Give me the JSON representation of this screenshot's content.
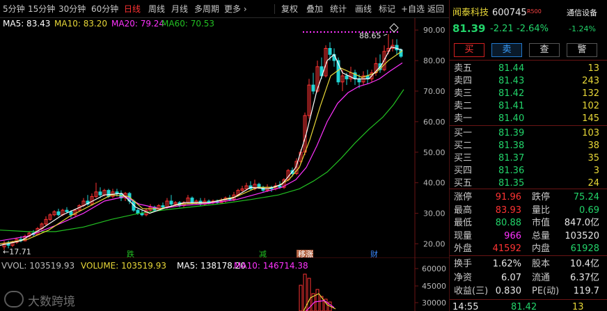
{
  "toolbar": {
    "periods": [
      "5分钟",
      "15分钟",
      "30分钟",
      "60分钟",
      "日线",
      "周线",
      "月线",
      "多周期",
      "更多 ›"
    ],
    "active": "日线",
    "actions": [
      "复权",
      "叠加",
      "统计",
      "画线",
      "标记",
      "+自选",
      "返回"
    ]
  },
  "legend": {
    "ma5": "MA5: 83.43",
    "ma10": "MA10: 83.20",
    "ma20": "MA20: 79.24",
    "ma60": "MA60: 70.53"
  },
  "chart_data": {
    "type": "candlestick",
    "y_ticks": [
      "90.00",
      "80.00",
      "70.00",
      "60.00",
      "50.00",
      "40.00",
      "30.00",
      "20.00"
    ],
    "ylim": [
      16,
      93
    ],
    "high_label": "88.65",
    "low_label": "←17.71",
    "high": 88.65,
    "low": 17.71,
    "events": [
      "跌",
      "减",
      "移涨",
      "财"
    ],
    "series": [
      {
        "name": "MA5",
        "color": "#ffffff",
        "last": 83.43
      },
      {
        "name": "MA10",
        "color": "#e8d838",
        "last": 83.2
      },
      {
        "name": "MA20",
        "color": "#ff33ff",
        "last": 79.24
      },
      {
        "name": "MA60",
        "color": "#22c022",
        "last": 70.53
      }
    ],
    "volume": {
      "ticks": [
        "60000",
        "45000",
        "30000"
      ]
    }
  },
  "colors": {
    "up": "#ff3333",
    "down": "#22d4d4",
    "ma5": "#ffffff",
    "ma10": "#e8d838",
    "ma20": "#ff33ff",
    "ma60": "#22c022",
    "volume": "#e8d838"
  },
  "vlegend": {
    "vvol": "VVOL: 103519.93",
    "volume": "VOLUME: 103519.93",
    "ma5": "MA5: 138178.20",
    "ma10": "MA10: 146714.38"
  },
  "watermark": "大数跨境",
  "quote": {
    "name": "闻泰科技",
    "code": "600745",
    "badge": "R500",
    "industry": "通信设备",
    "price": "81.39",
    "change": "-2.21",
    "pct": "-2.64%",
    "industry_pct": "-1.24%",
    "buttons": [
      "买",
      "卖",
      "查",
      "警"
    ],
    "asks": [
      {
        "label": "卖五",
        "price": "81.44",
        "vol": "13"
      },
      {
        "label": "卖四",
        "price": "81.43",
        "vol": "243"
      },
      {
        "label": "卖三",
        "price": "81.42",
        "vol": "132"
      },
      {
        "label": "卖二",
        "price": "81.41",
        "vol": "102"
      },
      {
        "label": "卖一",
        "price": "81.40",
        "vol": "145"
      }
    ],
    "bids": [
      {
        "label": "买一",
        "price": "81.39",
        "vol": "103"
      },
      {
        "label": "买二",
        "price": "81.38",
        "vol": "38"
      },
      {
        "label": "买三",
        "price": "81.37",
        "vol": "35"
      },
      {
        "label": "买四",
        "price": "81.36",
        "vol": "3"
      },
      {
        "label": "买五",
        "price": "81.35",
        "vol": "24"
      }
    ],
    "stats": [
      {
        "l1": "涨停",
        "v1": "91.96",
        "c1": "red",
        "l2": "跌停",
        "v2": "75.24",
        "c2": "green"
      },
      {
        "l1": "最高",
        "v1": "83.93",
        "c1": "red",
        "l2": "量比",
        "v2": "0.69",
        "c2": "green"
      },
      {
        "l1": "最低",
        "v1": "80.88",
        "c1": "green",
        "l2": "市值",
        "v2": "847.0亿",
        "c2": "wht"
      },
      {
        "l1": "现量",
        "v1": "966",
        "c1": "mag",
        "l2": "总量",
        "v2": "103520",
        "c2": "wht"
      },
      {
        "l1": "外盘",
        "v1": "41592",
        "c1": "red",
        "l2": "内盘",
        "v2": "61928",
        "c2": "green"
      }
    ],
    "stats2": [
      {
        "l1": "换手",
        "v1": "1.62%",
        "c1": "wht",
        "l2": "股本",
        "v2": "10.4亿",
        "c2": "wht"
      },
      {
        "l1": "净资",
        "v1": "6.07",
        "c1": "wht",
        "l2": "流通",
        "v2": "6.37亿",
        "c2": "wht"
      },
      {
        "l1": "收益(三)",
        "v1": "0.830",
        "c1": "wht",
        "l2": "PE(动)",
        "v2": "119.7",
        "c2": "wht"
      }
    ],
    "tick": {
      "time": "14:55",
      "price": "81.42",
      "vol": "13"
    }
  }
}
